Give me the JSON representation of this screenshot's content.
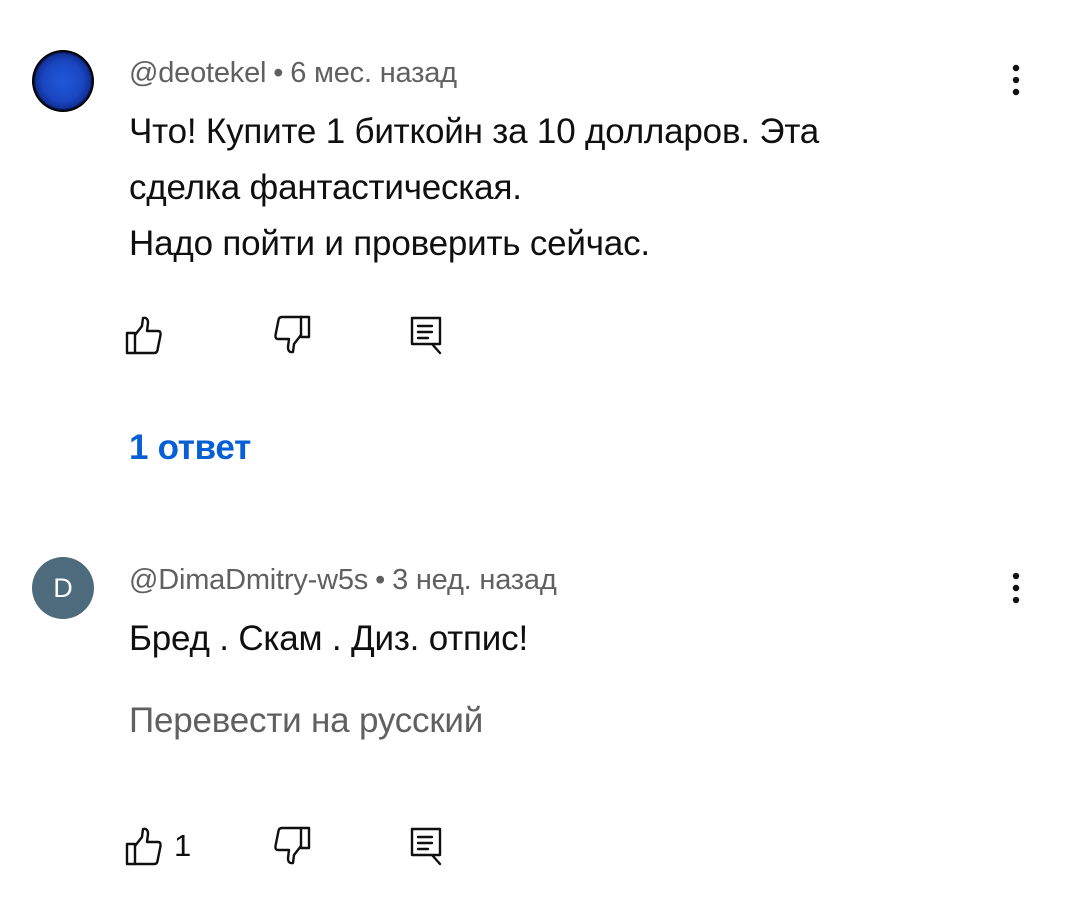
{
  "comments": [
    {
      "author": "@deotekel",
      "separator": "•",
      "time": "6 мес. назад",
      "text_lines": [
        "Что! Купите 1 биткойн за 10 долларов. Эта",
        "сделка фантастическая.",
        "Надо пойти и проверить сейчас."
      ],
      "avatar": "planet-avatar",
      "like_count": "",
      "replies_label": "1 ответ"
    },
    {
      "author": "@DimaDmitry-w5s",
      "separator": "•",
      "time": "3 нед. назад",
      "text_lines": [
        "Бред . Скам . Диз. отпис!"
      ],
      "avatar_letter": "D",
      "avatar_color": "#4d6b7d",
      "translate_label": "Перевести на русский",
      "like_count": "1"
    }
  ],
  "icons": {
    "like": "thumbs-up-icon",
    "dislike": "thumbs-down-icon",
    "reply": "reply-comment-icon",
    "menu": "more-vertical-icon"
  },
  "colors": {
    "link": "#065fd4",
    "meta": "#606060",
    "text": "#0f0f0f"
  }
}
